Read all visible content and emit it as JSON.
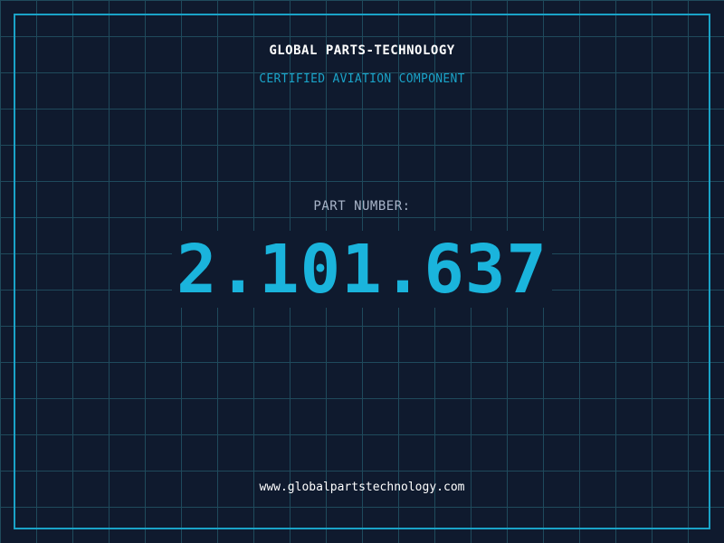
{
  "header": {
    "company_name": "GLOBAL PARTS-TECHNOLOGY",
    "tagline": "CERTIFIED AVIATION COMPONENT"
  },
  "part": {
    "label": "PART NUMBER:",
    "number": "2.101.637"
  },
  "footer": {
    "website": "www.globalpartstechnology.com"
  },
  "colors": {
    "background": "#0f1a2e",
    "grid": "#1f4a5c",
    "accent": "#1aa3c8",
    "part_number": "#1ab4dc",
    "label": "#a8b4c8",
    "text": "#ffffff"
  }
}
